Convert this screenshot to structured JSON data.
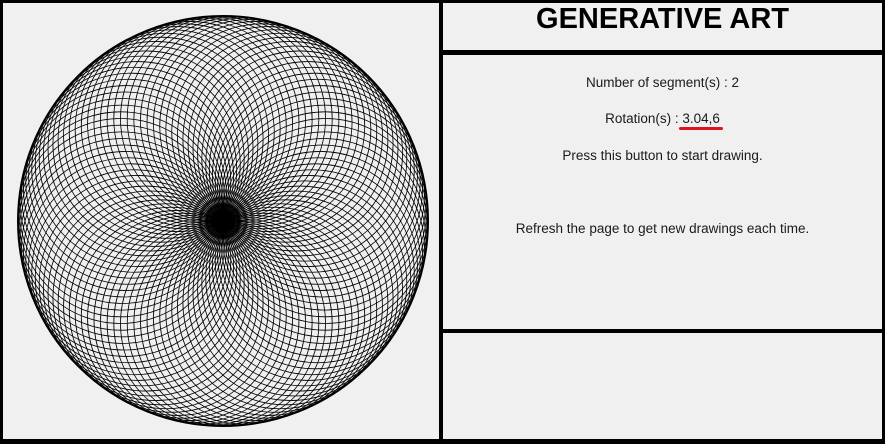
{
  "header": {
    "title": "GENERATIVE ART"
  },
  "info": {
    "segments_label": "Number of segment(s) : ",
    "segments_value": "2",
    "rotations_label": "Rotation(s) : ",
    "rotations_value": "3.04,6",
    "press_text": "Press this button to start drawing.",
    "refresh_text": "Refresh the page to get new drawings each time."
  },
  "artwork": {
    "stroke_color": "#000000",
    "background": "#f0f0f0",
    "highlight_color": "#e0121e"
  }
}
